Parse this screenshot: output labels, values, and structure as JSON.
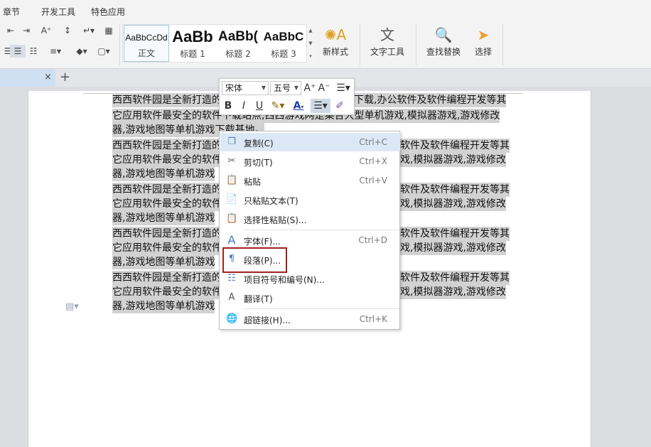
{
  "menu_tabs": [
    "章节",
    "开发工具",
    "特色应用"
  ],
  "ribbon": {
    "styles": [
      {
        "preview": "AaBbCcDd",
        "label": "正文"
      },
      {
        "preview": "AaBb",
        "label": "标题 1"
      },
      {
        "preview": "AaBb(",
        "label": "标题 2"
      },
      {
        "preview": "AaBbC",
        "label": "标题 3"
      }
    ],
    "new_style": "新样式",
    "text_tools": "文字工具",
    "find_replace": "查找替换",
    "select": "选择"
  },
  "doc_tab": {
    "close": "×",
    "new": "+"
  },
  "document": {
    "lines": [
      "西西软件园是全新打造的",
      "它应用软件最安全的软件下载站点,西西游戏网是集合大型单机游戏,模拟器游戏,游戏修改",
      "器,游戏地图等单机游戏下载基地。",
      "西西软件园是全新打造的",
      "它应用软件最安全的软件",
      "器,游戏地图等单机游戏",
      "西西软件园是全新打造的",
      "它应用软件最安全的软件",
      "器,游戏地图等单机游戏",
      "西西软件园是全新打造的",
      "它应用软件最安全的软件",
      "器,游戏地图等单机游戏",
      "西西软件园是全新打造的",
      "它应用软件最安全的软件",
      "器,游戏地图等单机游戏"
    ],
    "right_fragments": [
      "下载,办公软件及软件编程开发等其",
      "软件及软件编程开发等其",
      "戏,模拟器游戏,游戏修改",
      "软件及软件编程开发等其",
      "戏,模拟器游戏,游戏修改",
      "软件及软件编程开发等其",
      "戏,模拟器游戏,游戏修改",
      "软件及软件编程开发等其",
      "戏,模拟器游戏,游戏修改"
    ]
  },
  "minibar": {
    "font": "宋体",
    "size": "五号",
    "grow": "A⁺",
    "shrink": "A⁻",
    "bold": "B",
    "italic": "I",
    "underline": "U",
    "font_color": "A"
  },
  "context_menu": {
    "items": [
      {
        "icon": "copy-icon",
        "label": "复制(C)",
        "shortcut": "Ctrl+C"
      },
      {
        "icon": "cut-icon",
        "label": "剪切(T)",
        "shortcut": "Ctrl+X"
      },
      {
        "icon": "paste-icon",
        "label": "粘贴",
        "shortcut": "Ctrl+V"
      },
      {
        "icon": "paste-text-icon",
        "label": "只粘贴文本(T)",
        "shortcut": ""
      },
      {
        "icon": "paste-special-icon",
        "label": "选择性粘贴(S)...",
        "shortcut": ""
      },
      {
        "icon": "font-icon",
        "label": "字体(F)...",
        "shortcut": "Ctrl+D"
      },
      {
        "icon": "paragraph-icon",
        "label": "段落(P)...",
        "shortcut": ""
      },
      {
        "icon": "list-numbering-icon",
        "label": "项目符号和编号(N)...",
        "shortcut": ""
      },
      {
        "icon": "translate-icon",
        "label": "翻译(T)",
        "shortcut": ""
      },
      {
        "icon": "hyperlink-icon",
        "label": "超链接(H)...",
        "shortcut": "Ctrl+K"
      }
    ]
  },
  "colors": {
    "accent": "#2b5fb0",
    "highlight": "#dde8f6",
    "annotation_box": "#a02020",
    "selection": "#d2d2d2"
  }
}
